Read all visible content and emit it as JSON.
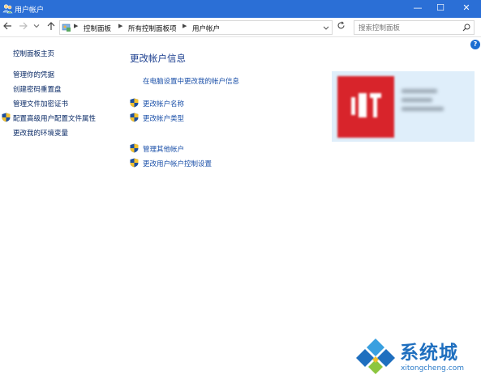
{
  "window": {
    "title": "用户帐户",
    "controls": {
      "minimize": "—",
      "maximize": "☐",
      "close": "✕"
    }
  },
  "nav": {
    "back_icon": "arrow-left-icon",
    "forward_icon": "arrow-right-icon",
    "breadcrumb": [
      "控制面板",
      "所有控制面板项",
      "用户帐户"
    ],
    "search_placeholder": "搜索控制面板"
  },
  "help_label": "?",
  "sidebar": {
    "home": "控制面板主页",
    "items": [
      {
        "label": "管理你的凭据",
        "shield": false
      },
      {
        "label": "创建密码重置盘",
        "shield": false
      },
      {
        "label": "管理文件加密证书",
        "shield": false
      },
      {
        "label": "配置高级用户配置文件属性",
        "shield": true
      },
      {
        "label": "更改我的环境变量",
        "shield": false
      }
    ]
  },
  "main": {
    "heading": "更改帐户信息",
    "pc_settings_link": "在电脑设置中更改我的帐户信息",
    "links": [
      {
        "label": "更改帐户名称",
        "shield": true
      },
      {
        "label": "更改帐户类型",
        "shield": true
      },
      {
        "label": "管理其他帐户",
        "shield": true
      },
      {
        "label": "更改用户帐户控制设置",
        "shield": true
      }
    ]
  },
  "watermark": {
    "title": "系统城",
    "url": "xitongcheng.com"
  },
  "colors": {
    "titlebar": "#2b6fd6",
    "link": "#1a4fa8",
    "heading": "#1b3e8f",
    "account_panel": "#dfeefa",
    "avatar": "#d8242b"
  }
}
